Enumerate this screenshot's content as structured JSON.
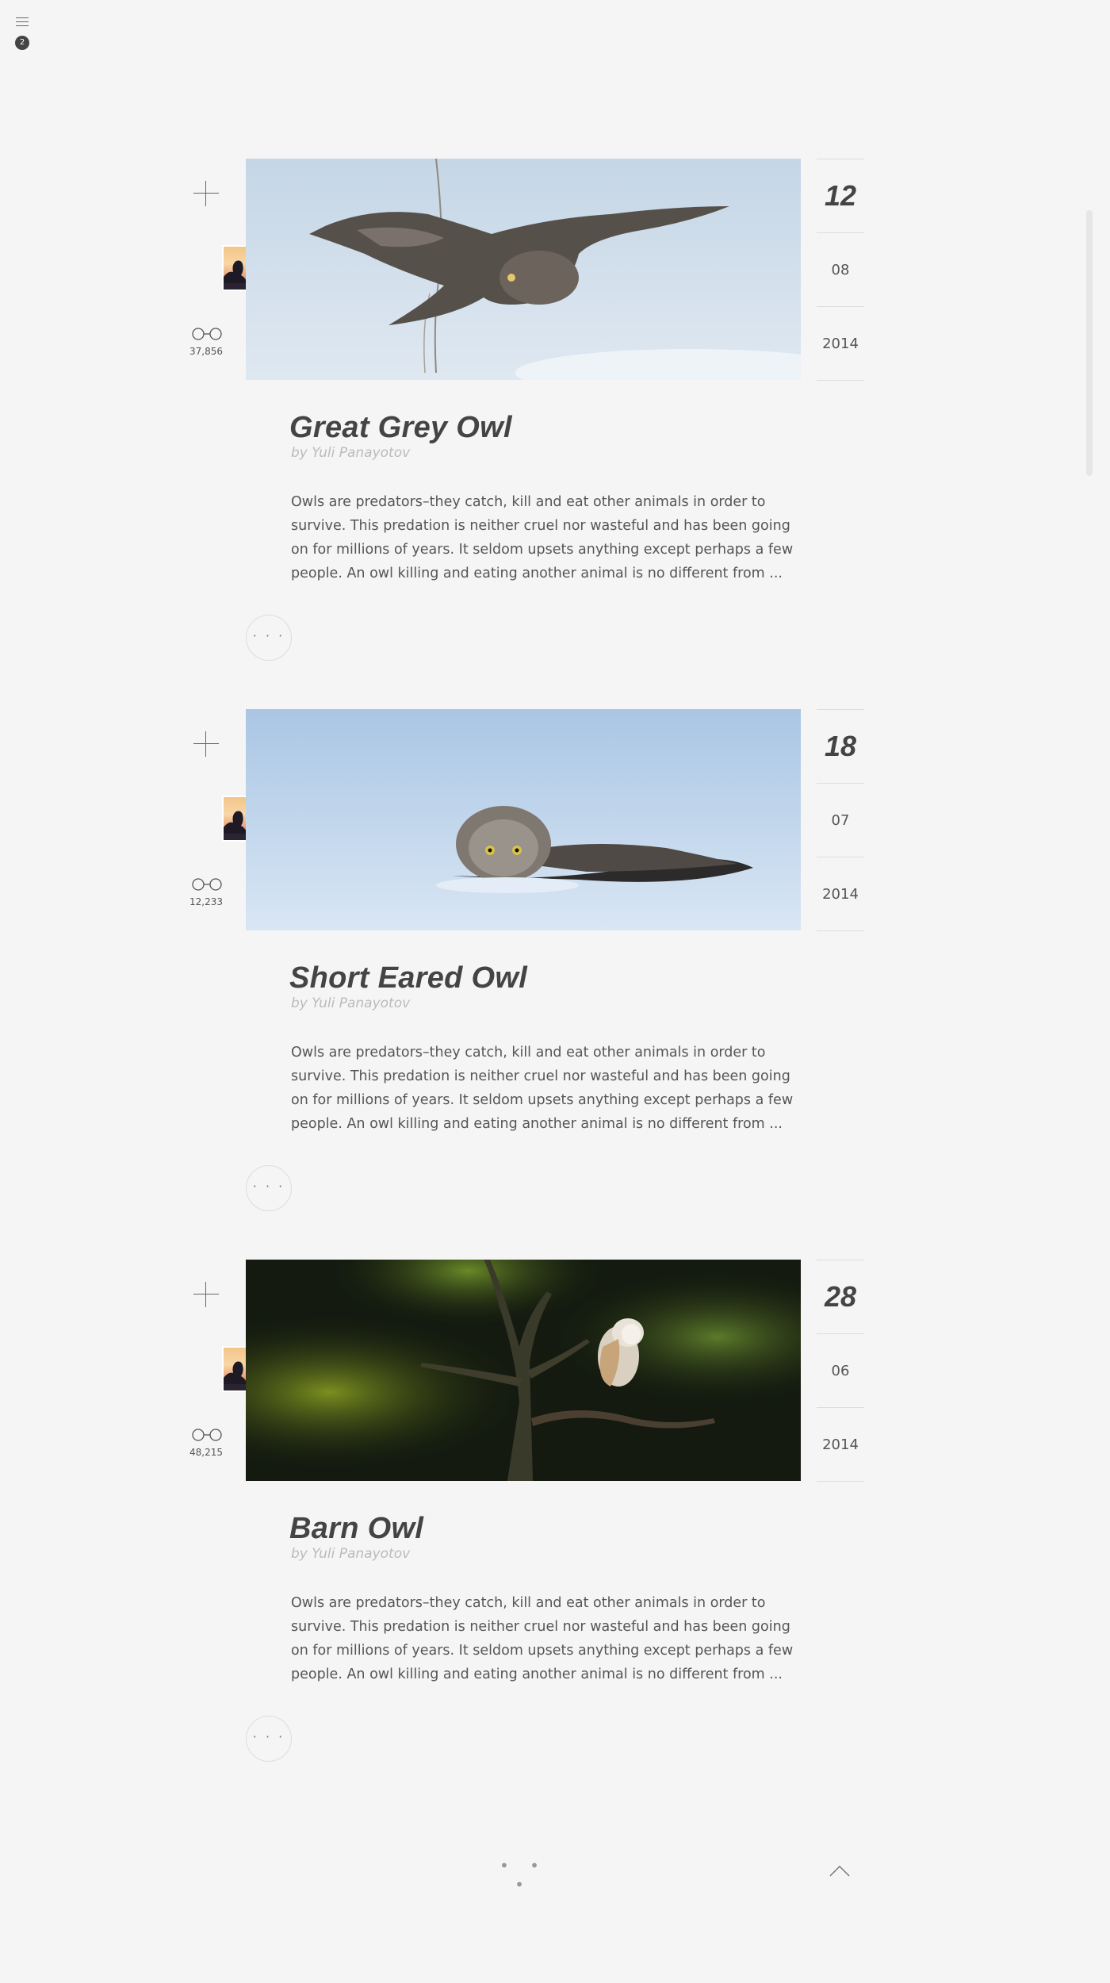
{
  "menu": {
    "icon": "hamburger-icon",
    "badge": "2"
  },
  "posts": [
    {
      "title": "Great Grey Owl",
      "author": "by Yuli Panayotov",
      "excerpt": "Owls are predators–they catch, kill and eat other animals in order to survive. This predation is neither cruel nor wasteful and has been going on for millions of years. It seldom upsets anything except perhaps a few people. An owl killing and eating another animal is no different from ...",
      "views": "37,856",
      "day": "12",
      "month": "08",
      "year": "2014",
      "more_label": "· · ·"
    },
    {
      "title": "Short Eared Owl",
      "author": "by Yuli Panayotov",
      "excerpt": "Owls are predators–they catch, kill and eat other animals in order to survive. This predation is neither cruel nor wasteful and has been going on for millions of years. It seldom upsets anything except perhaps a few people. An owl killing and eating another animal is no different from ...",
      "views": "12,233",
      "day": "18",
      "month": "07",
      "year": "2014",
      "more_label": "· · ·"
    },
    {
      "title": "Barn Owl",
      "author": "by Yuli Panayotov",
      "excerpt": "Owls are predators–they catch, kill and eat other animals in order to survive. This predation is neither cruel nor wasteful and has been going on for millions of years. It seldom upsets anything except perhaps a few people. An owl killing and eating another animal is no different from ...",
      "views": "48,215",
      "day": "28",
      "month": "06",
      "year": "2014",
      "more_label": "· · ·"
    }
  ],
  "footer": {
    "pagination_label": "• • •",
    "to_top_icon": "chevron-up-icon"
  }
}
